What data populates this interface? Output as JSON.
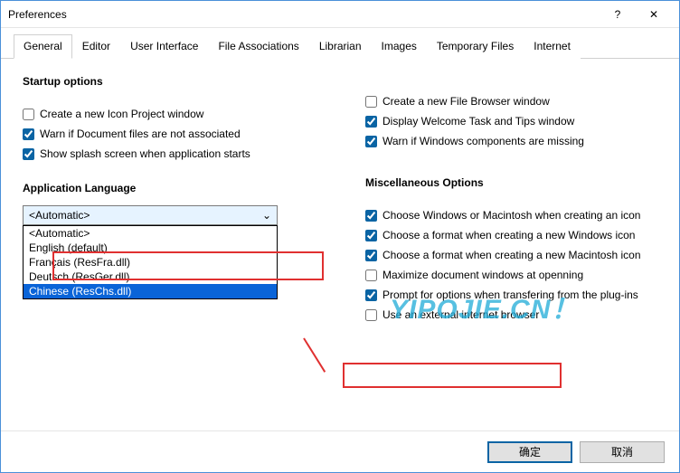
{
  "window": {
    "title": "Preferences"
  },
  "tabs": [
    "General",
    "Editor",
    "User Interface",
    "File Associations",
    "Librarian",
    "Images",
    "Temporary Files",
    "Internet"
  ],
  "activeTab": 0,
  "left": {
    "startup_heading": "Startup options",
    "c1": "Create a new Icon Project window",
    "c2": "Warn if Document files are not associated",
    "c3": "Show splash screen when application starts",
    "lang_heading": "Application Language",
    "dropdown_current": "<Automatic>",
    "dropdown_items": [
      "<Automatic>",
      "English (default)",
      "Français (ResFra.dll)",
      "Deutsch (ResGer.dll)",
      "Chinese (ResChs.dll)"
    ],
    "dropdown_selected": 4
  },
  "right": {
    "misc_heading": "Miscellaneous Options",
    "r1": "Create a new File Browser window",
    "r2": "Display Welcome Task and Tips window",
    "r3": "Warn if Windows components are missing",
    "r4": "Choose Windows or Macintosh when creating an icon",
    "r5": "Choose a format when creating a new Windows icon",
    "r6": "Choose a format when creating a new Macintosh icon",
    "r7": "Maximize document windows at openning",
    "r8": "Prompt for options when transfering from the plug-ins",
    "r9": "Use an external internet browser"
  },
  "buttons": {
    "ok": "确定",
    "cancel": "取消"
  },
  "watermark": "YIPOJIE.CN！",
  "watermark2": "YIPOJIE.CN ！"
}
